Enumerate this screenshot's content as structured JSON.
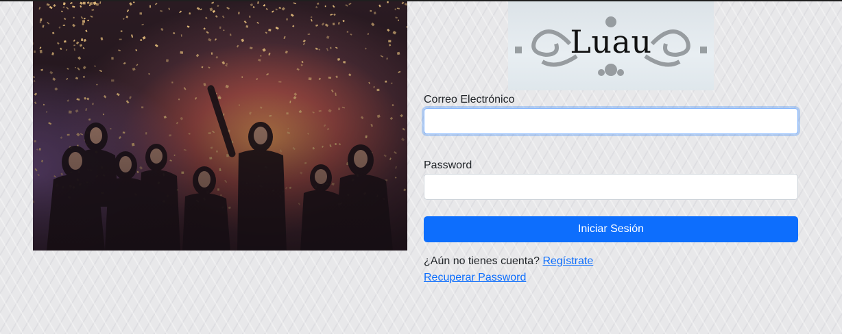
{
  "logo": {
    "text": "Luau"
  },
  "hero": {
    "icon": "party-photo"
  },
  "form": {
    "email_label": "Correo Electrónico",
    "email_value": "",
    "password_label": "Password",
    "password_value": "",
    "submit_label": "Iniciar Sesión",
    "register_prompt": "¿Aún no tienes cuenta? ",
    "register_link": "Regístrate",
    "recover_link": "Recuperar Password"
  },
  "colors": {
    "primary": "#0d6efd",
    "focus_border": "#86b7fe",
    "text": "#212529",
    "background": "#e8e8ea"
  }
}
